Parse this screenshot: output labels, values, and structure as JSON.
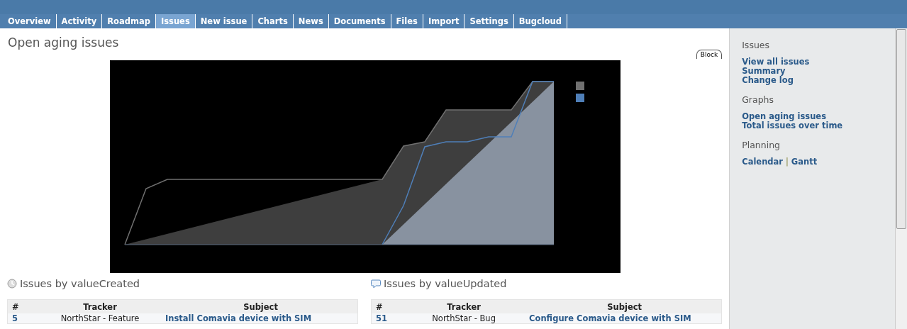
{
  "tabs": [
    {
      "label": "Overview",
      "selected": false
    },
    {
      "label": "Activity",
      "selected": false
    },
    {
      "label": "Roadmap",
      "selected": false
    },
    {
      "label": "Issues",
      "selected": true
    },
    {
      "label": "New issue",
      "selected": false
    },
    {
      "label": "Charts",
      "selected": false
    },
    {
      "label": "News",
      "selected": false
    },
    {
      "label": "Documents",
      "selected": false
    },
    {
      "label": "Files",
      "selected": false
    },
    {
      "label": "Import",
      "selected": false
    },
    {
      "label": "Settings",
      "selected": false
    },
    {
      "label": "Bugcloud",
      "selected": false
    }
  ],
  "page_title": "Open aging issues",
  "block_button": "Block",
  "chart": {
    "legend": [
      {
        "color": "#707070"
      },
      {
        "color": "#4f7fb8"
      }
    ]
  },
  "boxes": [
    {
      "kind": "created",
      "title": "Issues by valueCreated",
      "columns": [
        "#",
        "Tracker",
        "Subject"
      ],
      "rows": [
        {
          "id": "5",
          "tracker": "NorthStar - Feature",
          "subject": "Install Comavia device with SIM"
        }
      ]
    },
    {
      "kind": "updated",
      "title": "Issues by valueUpdated",
      "columns": [
        "#",
        "Tracker",
        "Subject"
      ],
      "rows": [
        {
          "id": "51",
          "tracker": "NorthStar - Bug",
          "subject": "Configure Comavia device with SIM"
        }
      ]
    }
  ],
  "sidebar": [
    {
      "title": "Issues",
      "rows": [
        [
          "View all issues"
        ],
        [
          "Summary"
        ],
        [
          "Change log"
        ]
      ]
    },
    {
      "title": "Graphs",
      "rows": [
        [
          "Open aging issues"
        ],
        [
          "Total issues over time"
        ]
      ]
    },
    {
      "title": "Planning",
      "rows": [
        [
          "Calendar",
          "Gantt"
        ]
      ],
      "separator": "|"
    }
  ]
}
